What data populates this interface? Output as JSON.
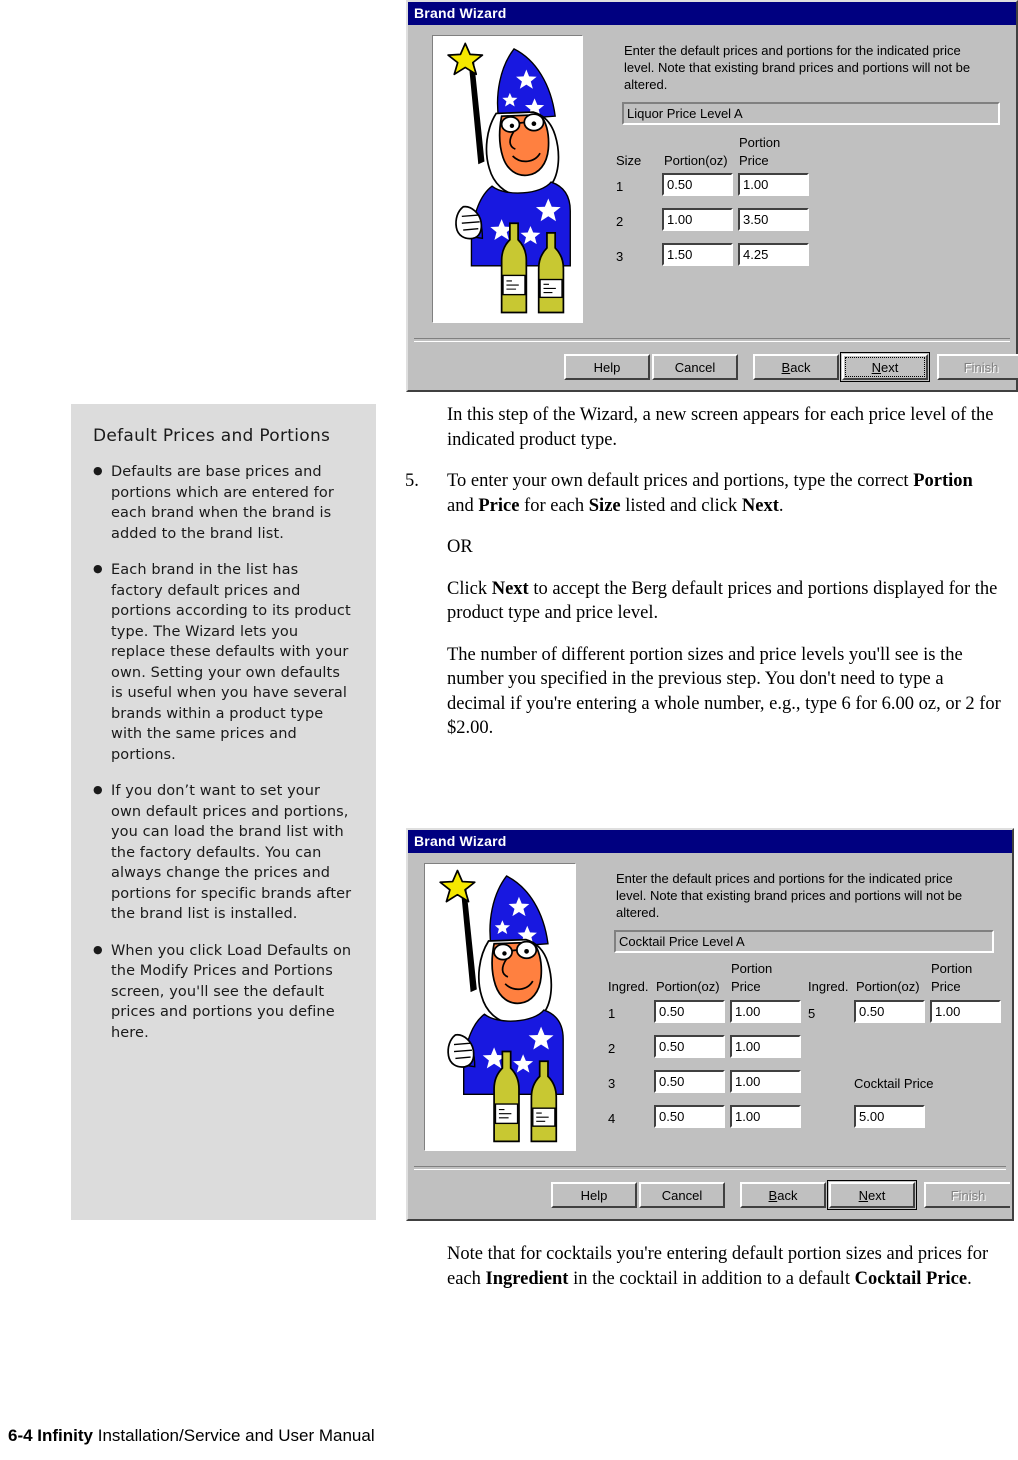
{
  "page": {
    "footer_bold": "6-4 Infinity",
    "footer_rest": " Installation/Service and User Manual"
  },
  "sidebar": {
    "heading": "Default Prices and Portions",
    "bullets": [
      "Defaults are base prices and portions which are entered for each brand when the brand is added to the brand list.",
      "Each brand in the list has factory default prices and portions according to its product type. The Wizard lets you replace these defaults with your own. Setting your own defaults is useful when you have several brands within a product type with the same prices and portions.",
      "If you don’t want to set your own default prices and portions, you can load the brand list with the factory defaults. You can always change the prices and portions for specific brands after the brand list is installed.",
      "When you click Load Defaults on the Modify Prices and Portions screen, you'll see the default prices and portions you define here."
    ]
  },
  "body": {
    "intro": "In this step of the Wizard, a new screen appears for each price level of the indicated product type.",
    "step5_number": "5.",
    "step5_parts": {
      "a": "To enter your own default prices and portions, type the correct ",
      "b_bold": "Portion",
      "c": " and ",
      "d_bold": "Price",
      "e": " for each ",
      "f_bold": "Size",
      "g": " listed and click ",
      "h_bold": "Next",
      "i": "."
    },
    "or": "OR",
    "click_next_parts": {
      "a": "Click ",
      "b_bold": "Next",
      "c": " to accept the Berg default prices and portions displayed for the product type and price level."
    },
    "portion_note": "The number of different portion sizes and price levels you'll see is the number you specified in the previous step. You don't need to type a decimal if you're entering a whole number, e.g., type 6 for 6.00 oz, or 2 for $2.00.",
    "cocktail_note_parts": {
      "a": "Note that for cocktails you're entering default portion sizes and prices for each ",
      "b_bold": "Ingredient",
      "c": " in the cocktail in addition to a default ",
      "d_bold": "Cocktail Price",
      "e": "."
    }
  },
  "dialog_liquor": {
    "title": "Brand Wizard",
    "instructions": "Enter the default prices and portions for the indicated price level. Note that existing brand prices and portions will not be altered.",
    "level_value": "Liquor Price Level A",
    "headers": {
      "size": "Size",
      "portion_oz": "Portion(oz)",
      "portion": "Portion",
      "price": "Price"
    },
    "rows": [
      {
        "size": "1",
        "portion": "0.50",
        "price": "1.00"
      },
      {
        "size": "2",
        "portion": "1.00",
        "price": "3.50"
      },
      {
        "size": "3",
        "portion": "1.50",
        "price": "4.25"
      }
    ],
    "buttons": {
      "help": "Help",
      "cancel": "Cancel",
      "back_accel": "B",
      "back_rest": "ack",
      "next_accel": "N",
      "next_rest": "ext",
      "finish": "Finish"
    }
  },
  "dialog_cocktail": {
    "title": "Brand Wizard",
    "instructions": "Enter the default prices and portions for the indicated price level. Note that existing brand prices and portions will not be altered.",
    "level_value": "Cocktail Price Level A",
    "headers": {
      "ingred": "Ingred.",
      "portion_oz": "Portion(oz)",
      "portion": "Portion",
      "price": "Price",
      "ingred2": "Ingred.",
      "portion_oz2": "Portion(oz)",
      "portion2": "Portion",
      "price2": "Price",
      "cocktail_price": "Cocktail Price"
    },
    "rows_left": [
      {
        "ingred": "1",
        "portion": "0.50",
        "price": "1.00"
      },
      {
        "ingred": "2",
        "portion": "0.50",
        "price": "1.00"
      },
      {
        "ingred": "3",
        "portion": "0.50",
        "price": "1.00"
      },
      {
        "ingred": "4",
        "portion": "0.50",
        "price": "1.00"
      }
    ],
    "rows_right": [
      {
        "ingred": "5",
        "portion": "0.50",
        "price": "1.00"
      }
    ],
    "cocktail_price_value": "5.00",
    "buttons": {
      "help": "Help",
      "cancel": "Cancel",
      "back_accel": "B",
      "back_rest": "ack",
      "next_accel": "N",
      "next_rest": "ext",
      "finish": "Finish"
    }
  },
  "colors": {
    "titlebar": "#000080",
    "dialog_face": "#c0c0c0",
    "sidebar_bg": "#dcdcdc",
    "wizard_blue": "#1818e0",
    "wizard_star": "#f5e800",
    "wizard_skin": "#ff8040",
    "wizard_bottle": "#c8c832"
  }
}
